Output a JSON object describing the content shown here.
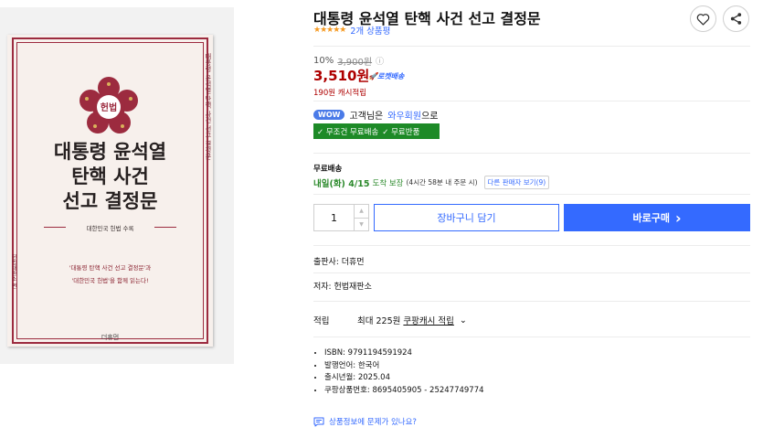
{
  "cover": {
    "emblem_text": "헌법",
    "title_lines": [
      "대통령 윤석열",
      "탄핵 사건",
      "선고 결정문"
    ],
    "subtitle": "대한민국 헌법 수록",
    "blurb_lines": [
      "'대통령 탄핵 사건 선고 결정문'과",
      "'대한민국 헌법'을 함께 읽는다!"
    ],
    "publisher_logo": "더휴먼",
    "spine_title": "대통령 윤석열 탄핵 사건 선고 결정문",
    "spine_author": "헌법재판소 편"
  },
  "product": {
    "title": "대통령 윤석열 탄핵 사건 선고 결정문",
    "stars": "★★★★★",
    "review_count": "2개 상품평",
    "discount_rate": "10%",
    "original_price": "3,900원",
    "info_icon": "ⓘ",
    "price": "3,510원",
    "rocket_label": "🚀로켓배송",
    "cash_reward": "190원 캐시적립",
    "wow_badge": "WOW",
    "wow_prefix": "고객님은",
    "wow_link": "와우회원",
    "wow_suffix": "으로",
    "benefit_1": "✓ 무조건 무료배송",
    "benefit_2": "✓ 무료반품"
  },
  "shipping": {
    "label": "무료배송",
    "date": "내일(화) 4/15",
    "guarantee": "도착 보장",
    "note": "(4시간 58분 내 주문 시)",
    "other_sellers": "다른 판매자 보기(9)"
  },
  "purchase": {
    "quantity": "1",
    "cart_label": "장바구니 담기",
    "buy_label": "바로구매",
    "buy_chevron": "›"
  },
  "details": {
    "publisher": "출판사: 더휴먼",
    "author": "저자: 헌법재판소",
    "reward_label": "적립",
    "reward_prefix": "최대 225원",
    "reward_link": "쿠팡캐시 적립",
    "reward_chevron": "⌄",
    "specs": [
      "ISBN: 9791194591924",
      "발행언어: 한국어",
      "출시년월: 2025.04",
      "쿠팡상품번호: 8695405905 - 25247749774"
    ],
    "report_link": "상품정보에 문제가 있나요?"
  },
  "colors": {
    "accent": "#346aff",
    "price": "#ae0000",
    "badge_green": "#1d8a27",
    "cover_accent": "#9c2b3f"
  }
}
